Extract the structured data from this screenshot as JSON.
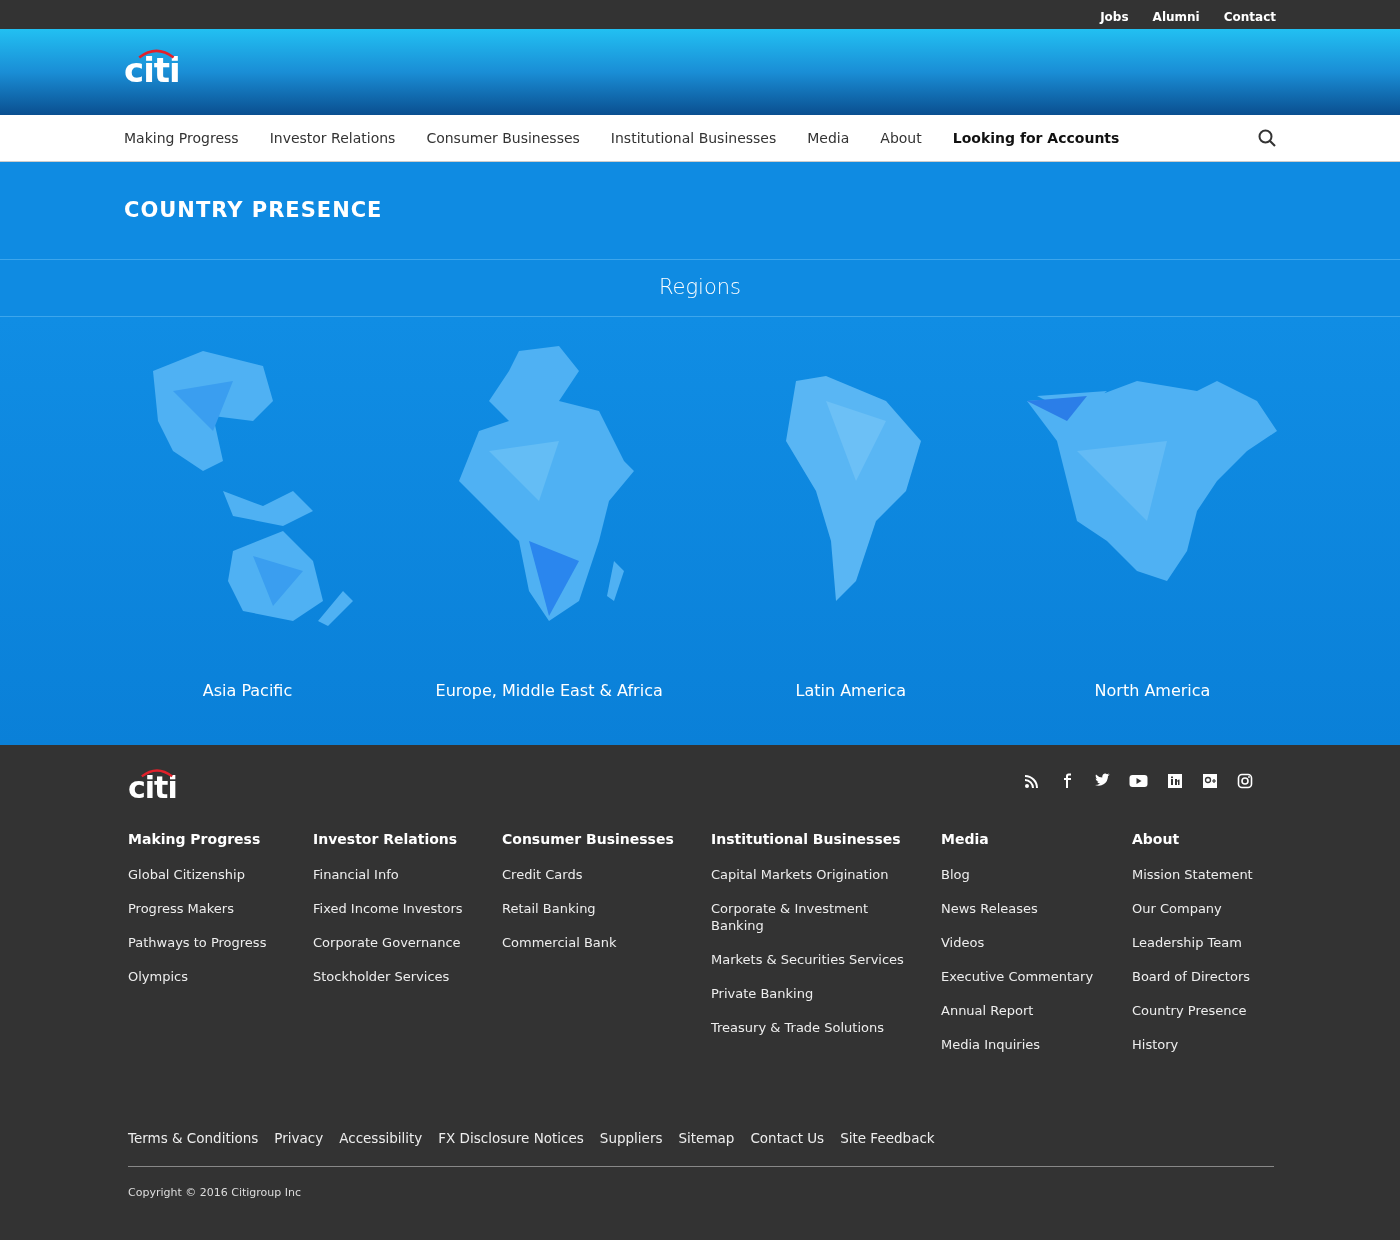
{
  "utility_links": [
    "Jobs",
    "Alumni",
    "Contact"
  ],
  "logo": "citi",
  "nav": [
    {
      "label": "Making Progress",
      "emphasis": false
    },
    {
      "label": "Investor Relations",
      "emphasis": false
    },
    {
      "label": "Consumer Businesses",
      "emphasis": false
    },
    {
      "label": "Institutional Businesses",
      "emphasis": false
    },
    {
      "label": "Media",
      "emphasis": false
    },
    {
      "label": "About",
      "emphasis": false
    },
    {
      "label": "Looking for Accounts",
      "emphasis": true
    }
  ],
  "page_title": "COUNTRY PRESENCE",
  "section_heading": "Regions",
  "regions": [
    {
      "name": "Asia Pacific",
      "kind": "asia"
    },
    {
      "name": "Europe, Middle East & Africa",
      "kind": "emea"
    },
    {
      "name": "Latin America",
      "kind": "latam"
    },
    {
      "name": "North America",
      "kind": "namerica"
    }
  ],
  "footer": {
    "logo": "citi",
    "social": [
      {
        "kind": "rss"
      },
      {
        "kind": "facebook"
      },
      {
        "kind": "twitter"
      },
      {
        "kind": "youtube"
      },
      {
        "kind": "linkedin"
      },
      {
        "kind": "googleplus"
      },
      {
        "kind": "instagram"
      }
    ],
    "columns": [
      {
        "heading": "Making Progress",
        "links": [
          "Global Citizenship",
          "Progress Makers",
          "Pathways to Progress",
          "Olympics"
        ]
      },
      {
        "heading": "Investor Relations",
        "links": [
          "Financial Info",
          "Fixed Income Investors",
          "Corporate Governance",
          "Stockholder Services"
        ]
      },
      {
        "heading": "Consumer Businesses",
        "links": [
          "Credit Cards",
          "Retail Banking",
          "Commercial Bank"
        ]
      },
      {
        "heading": "Institutional Businesses",
        "links": [
          "Capital Markets Origination",
          "Corporate & Investment Banking",
          "Markets & Securities Services",
          "Private Banking",
          "Treasury & Trade Solutions"
        ]
      },
      {
        "heading": "Media",
        "links": [
          "Blog",
          "News Releases",
          "Videos",
          "Executive Commentary",
          "Annual Report",
          "Media Inquiries"
        ]
      },
      {
        "heading": "About",
        "links": [
          "Mission Statement",
          "Our Company",
          "Leadership Team",
          "Board of Directors",
          "Country Presence",
          "History"
        ]
      }
    ],
    "legal_links": [
      "Terms & Conditions",
      "Privacy",
      "Accessibility",
      "FX Disclosure Notices",
      "Suppliers",
      "Sitemap",
      "Contact Us",
      "Site Feedback"
    ],
    "copyright": "Copyright © 2016 Citigroup Inc"
  }
}
